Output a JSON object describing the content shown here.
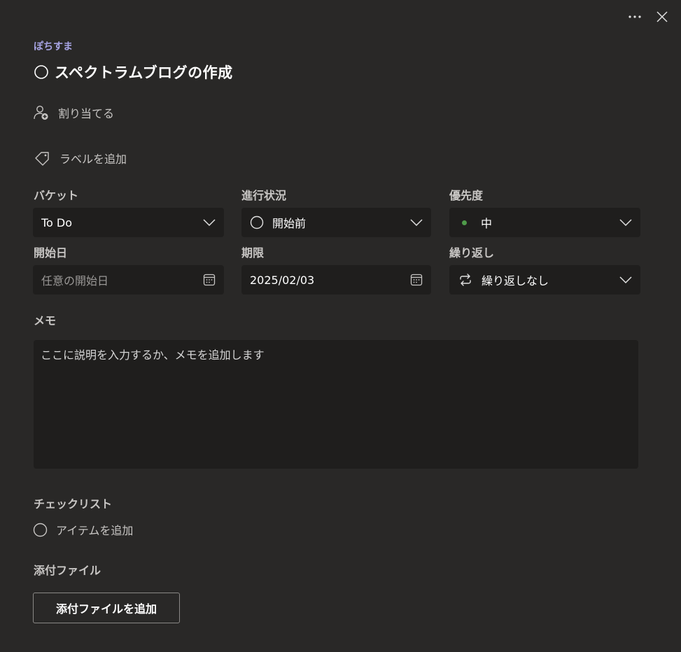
{
  "plan_name": "ぽちすま",
  "task_title": "スペクトラムブログの作成",
  "assign_label": "割り当てる",
  "label_add": "ラベルを追加",
  "fields": {
    "bucket": {
      "label": "バケット",
      "value": "To Do"
    },
    "progress": {
      "label": "進行状況",
      "value": "開始前"
    },
    "priority": {
      "label": "優先度",
      "value": "中",
      "dot_color": "#4f9b4a"
    },
    "start_date": {
      "label": "開始日",
      "placeholder": "任意の開始日"
    },
    "due_date": {
      "label": "期限",
      "value": "2025/02/03"
    },
    "repeat": {
      "label": "繰り返し",
      "value": "繰り返しなし"
    }
  },
  "memo": {
    "label": "メモ",
    "placeholder": "ここに説明を入力するか、メモを追加します"
  },
  "checklist": {
    "label": "チェックリスト",
    "add_item": "アイテムを追加"
  },
  "attachments": {
    "label": "添付ファイル",
    "add_button": "添付ファイルを追加"
  },
  "colors": {
    "background": "#292827",
    "field_bg": "#1f1e1d",
    "plan_accent": "#a7a4e3"
  }
}
